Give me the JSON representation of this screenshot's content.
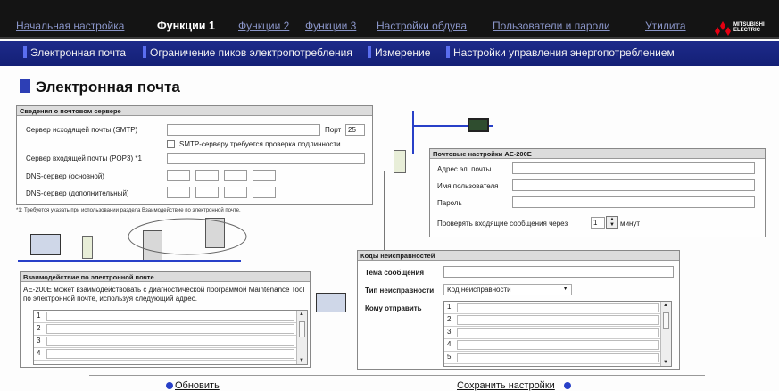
{
  "nav": {
    "items": [
      "Начальная настройка",
      "Функции 1",
      "Функции 2",
      "Функции 3",
      "Настройки обдува",
      "Пользователи и пароли",
      "Утилита"
    ],
    "active": "Функции 1",
    "logo_text": "MITSUBISHI ELECTRIC"
  },
  "subnav": {
    "items": [
      "Электронная почта",
      "Ограничение пиков электропотребления",
      "Измерение",
      "Настройки управления энергопотреблением"
    ]
  },
  "page_title": "Электронная почта",
  "mail_server": {
    "title": "Сведения о почтовом сервере",
    "smtp_label": "Сервер исходящей почты (SMTP)",
    "smtp_value": "",
    "port_label": "Порт",
    "port_value": "25",
    "auth_label": "SMTP-серверу требуется проверка подлинности",
    "pop3_label": "Сервер входящей почты (POP3) *1",
    "pop3_value": "",
    "dns1_label": "DNS-сервер (основной)",
    "dns2_label": "DNS-сервер (дополнительный)",
    "note": "*1: Требуется указать при использовании раздела Взаимодействие по электронной почте."
  },
  "mail_settings": {
    "title": "Почтовые настройки AE-200E",
    "address_label": "Адрес эл. почты",
    "address_value": "",
    "username_label": "Имя пользователя",
    "username_value": "",
    "password_label": "Пароль",
    "password_value": "",
    "check_label": "Проверять входящие сообщения через",
    "check_value": "1",
    "check_unit": "минут"
  },
  "interaction": {
    "title": "Взаимодействие по электронной почте",
    "description": "AE-200E может взаимодействовать с диагностической программой Maintenance Tool по электронной почте, используя следующий адрес.",
    "rows": [
      "1",
      "2",
      "3",
      "4"
    ]
  },
  "fault_codes": {
    "title": "Коды неисправностей",
    "subject_label": "Тема сообщения",
    "subject_value": "",
    "type_label": "Тип неисправности",
    "type_value": "Код неисправности",
    "recipients_label": "Кому отправить",
    "rows": [
      "1",
      "2",
      "3",
      "4",
      "5"
    ]
  },
  "footer": {
    "refresh_label": "Обновить",
    "save_label": "Сохранить настройки"
  }
}
